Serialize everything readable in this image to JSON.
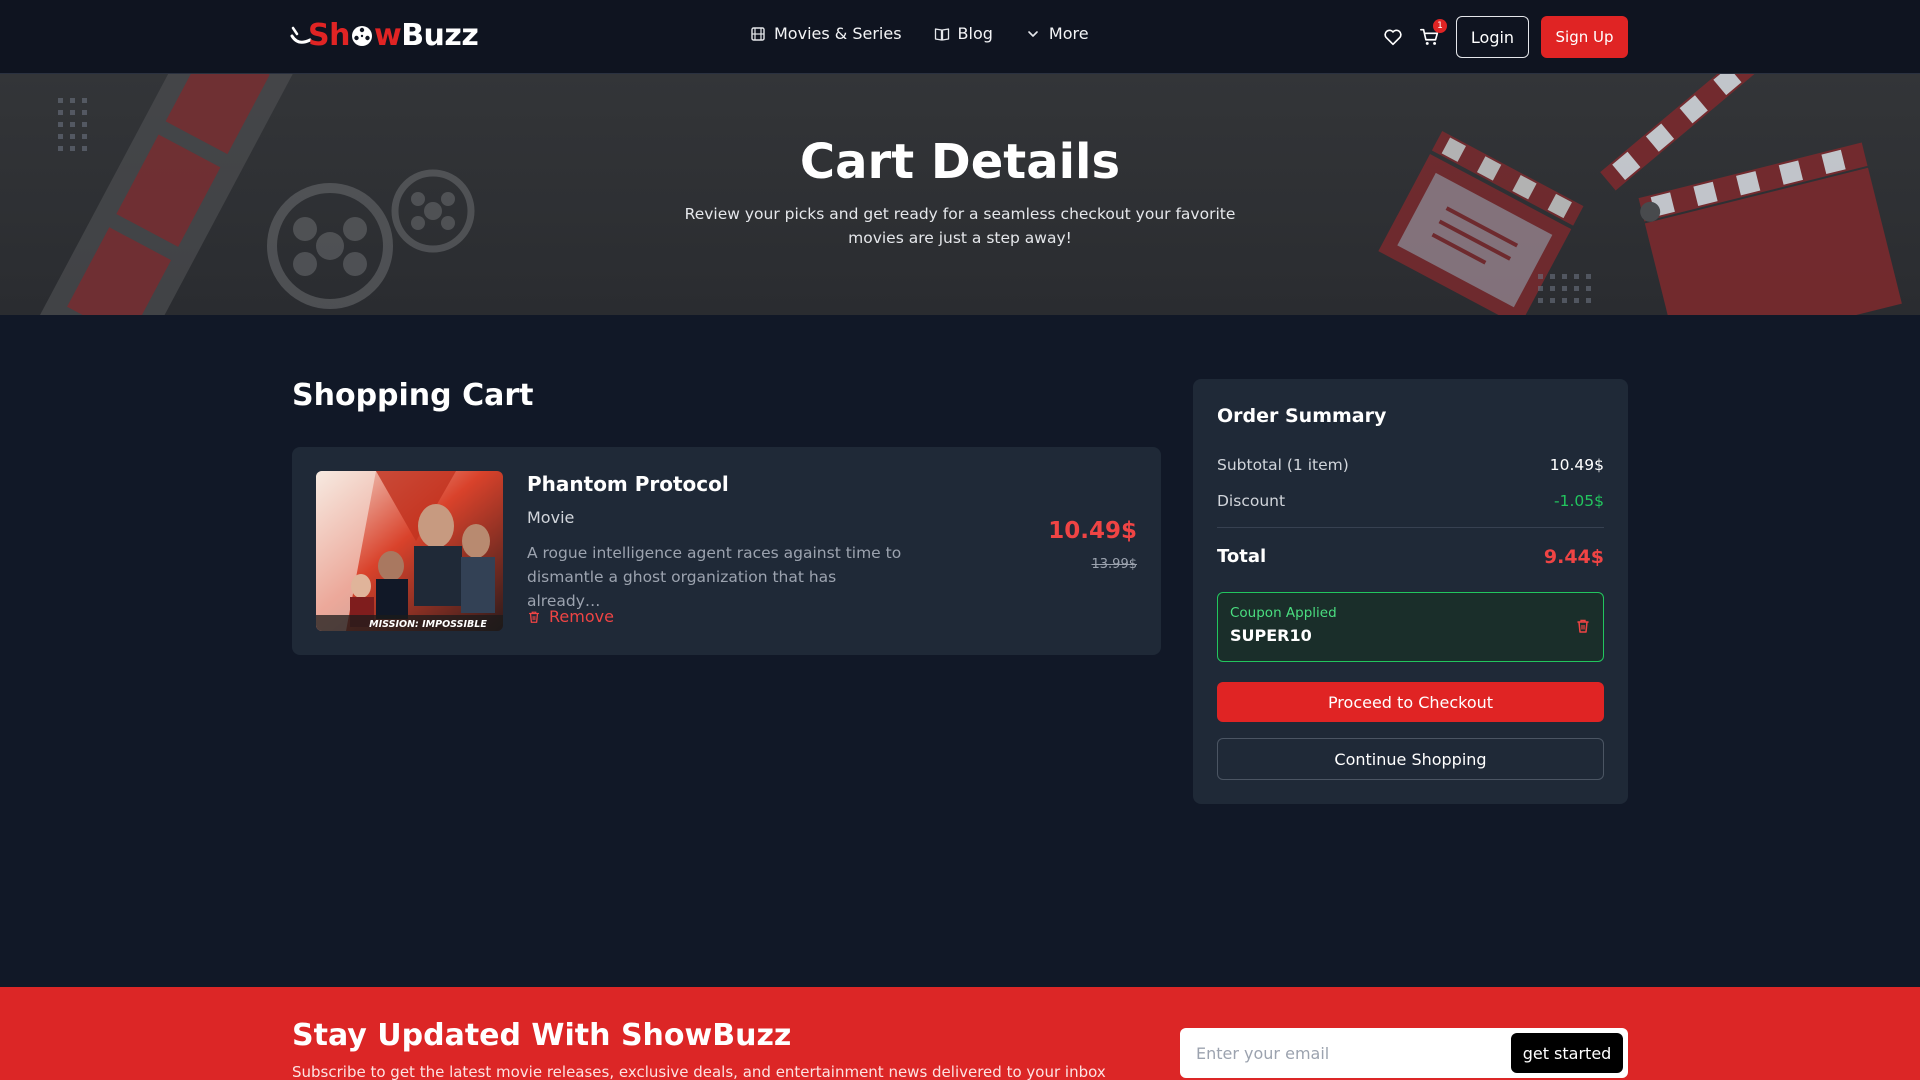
{
  "header": {
    "logo": {
      "part1": "Sh",
      "part2": "w",
      "part3": "Buzz"
    },
    "nav": [
      {
        "label": "Movies & Series",
        "icon": "film-icon"
      },
      {
        "label": "Blog",
        "icon": "book-icon"
      },
      {
        "label": "More",
        "icon": "chevron-down-icon"
      }
    ],
    "cart_count": "1",
    "login_label": "Login",
    "signup_label": "Sign Up"
  },
  "hero": {
    "title": "Cart Details",
    "subtitle": "Review your picks and get ready for a seamless checkout your favorite movies are just a step away!"
  },
  "cart": {
    "title": "Shopping Cart",
    "items": [
      {
        "title": "Phantom Protocol",
        "type": "Movie",
        "description": "A rogue intelligence agent races against time to dismantle a ghost organization that has already…",
        "poster_caption": "MISSION: IMPOSSIBLE",
        "price": "10.49$",
        "old_price": "13.99$",
        "remove_label": "Remove"
      }
    ]
  },
  "summary": {
    "title": "Order Summary",
    "subtotal_label": "Subtotal (1 item)",
    "subtotal_value": "10.49$",
    "discount_label": "Discount",
    "discount_value": "-1.05$",
    "total_label": "Total",
    "total_value": "9.44$",
    "coupon_label": "Coupon Applied",
    "coupon_code": "SUPER10",
    "checkout_label": "Proceed to Checkout",
    "continue_label": "Continue Shopping"
  },
  "newsletter": {
    "title": "Stay Updated With ShowBuzz",
    "subtitle": "Subscribe to get the latest movie releases, exclusive deals, and entertainment news delivered to your inbox",
    "placeholder": "Enter your email",
    "button_label": "get started"
  },
  "colors": {
    "accent": "#e02424",
    "background": "#111827",
    "card": "#1f2937",
    "success": "#22c55e"
  }
}
